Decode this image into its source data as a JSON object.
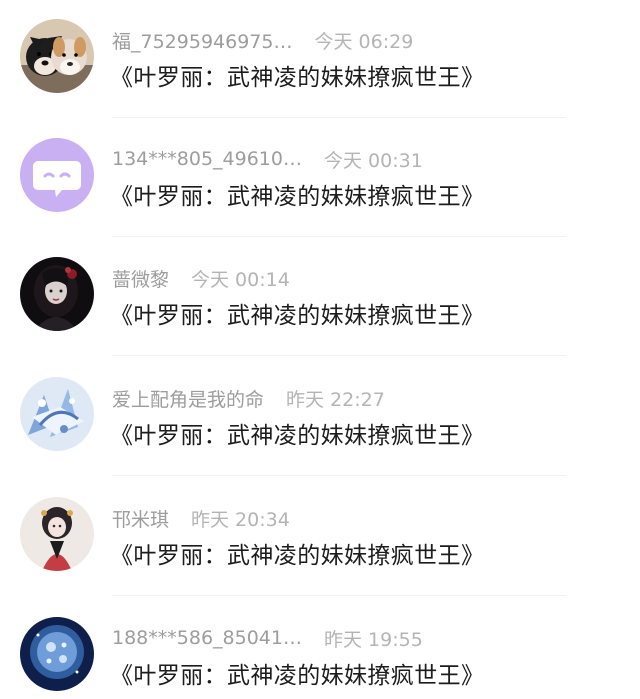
{
  "comments": [
    {
      "username": "福_75295946975…",
      "time": "今天 06:29",
      "text": "《叶罗丽：武神凌的妹妹撩疯世王》",
      "avatar": "dogs-avatar"
    },
    {
      "username": "134***805_49610…",
      "time": "今天 00:31",
      "text": "《叶罗丽：武神凌的妹妹撩疯世王》",
      "avatar": "default-chat-avatar"
    },
    {
      "username": "蔷微黎",
      "time": "今天 00:14",
      "text": "《叶罗丽：武神凌的妹妹撩疯世王》",
      "avatar": "dark-girl-avatar"
    },
    {
      "username": "爱上配角是我的命",
      "time": "昨天 22:27",
      "text": "《叶罗丽：武神凌的妹妹撩疯世王》",
      "avatar": "crystal-dragon-avatar"
    },
    {
      "username": "邗米琪",
      "time": "昨天 20:34",
      "text": "《叶罗丽：武神凌的妹妹撩疯世王》",
      "avatar": "anime-girl-avatar"
    },
    {
      "username": "188***586_85041…",
      "time": "昨天 19:55",
      "text": "《叶罗丽：武神凌的妹妹撩疯世王》",
      "avatar": "blue-moon-avatar"
    }
  ],
  "colors": {
    "username": "#9d9d9d",
    "time": "#b4b4b4",
    "comment_text": "#1c1c1c",
    "divider": "#f1f1f1",
    "default_avatar_bg": "#c9b0f2"
  }
}
